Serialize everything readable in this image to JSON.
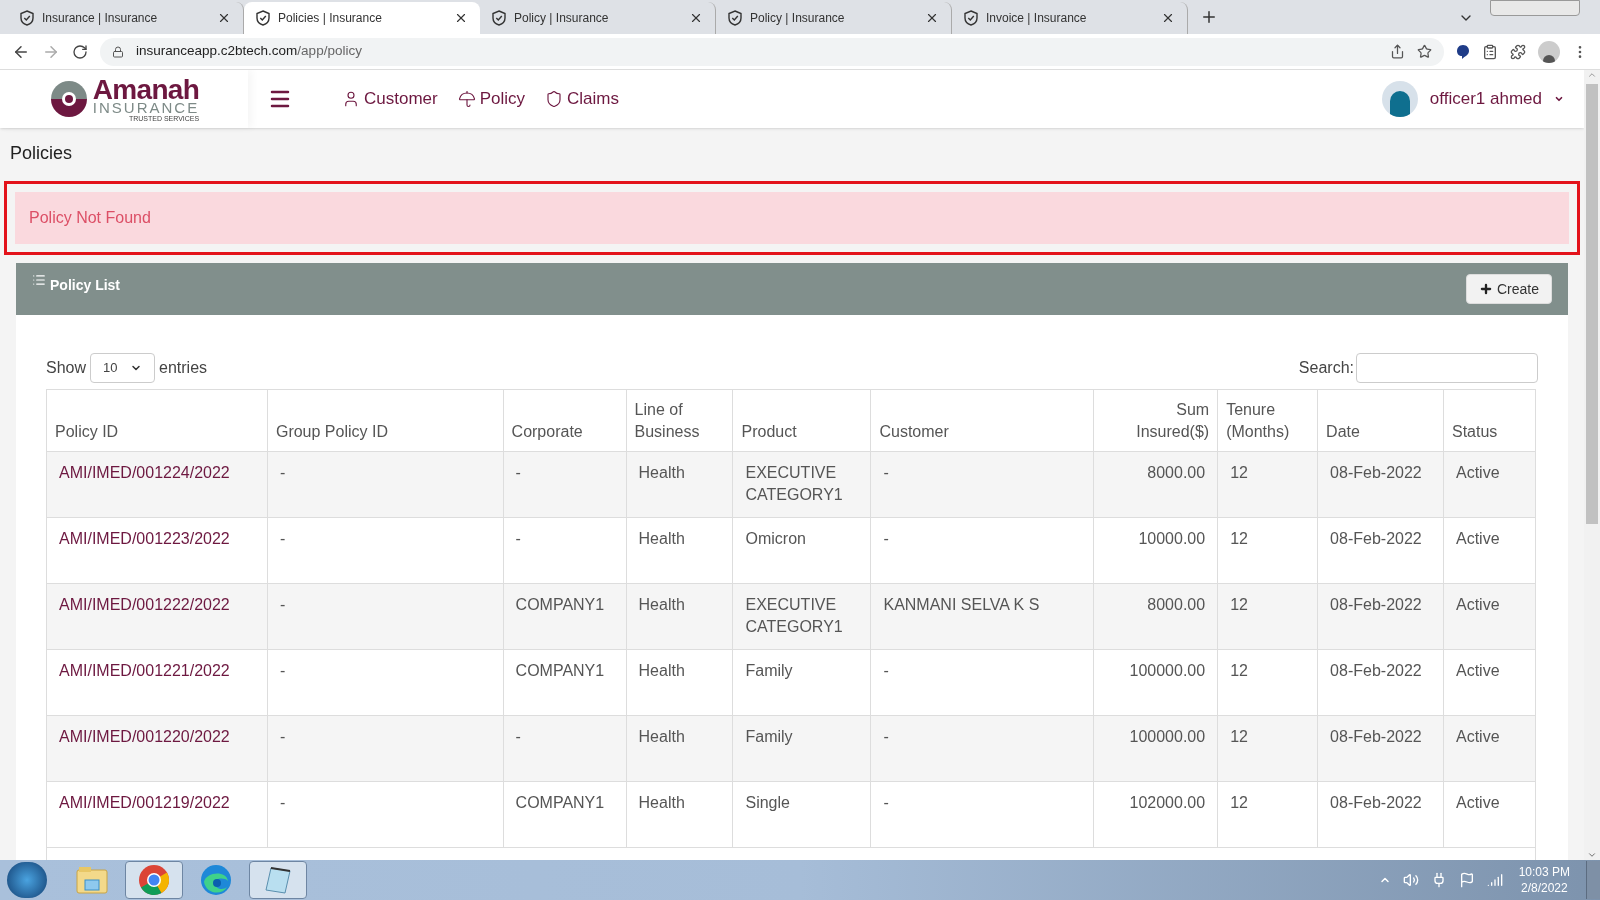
{
  "browser": {
    "tabs": [
      {
        "label": "Insurance | Insurance",
        "selected": false
      },
      {
        "label": "Policies | Insurance",
        "selected": true
      },
      {
        "label": "Policy | Insurance",
        "selected": false
      },
      {
        "label": "Policy | Insurance",
        "selected": false
      },
      {
        "label": "Invoice | Insurance",
        "selected": false
      }
    ],
    "url_host": "insuranceapp.c2btech.com",
    "url_path": "/app/policy"
  },
  "header": {
    "logo": {
      "name": "Amanah",
      "sub": "INSURANCE",
      "tagline": "TRUSTED SERVICES"
    },
    "nav": [
      {
        "label": "Customer",
        "kind": "person"
      },
      {
        "label": "Policy",
        "kind": "umbrella"
      },
      {
        "label": "Claims",
        "kind": "shield"
      }
    ],
    "user": "officer1 ahmed"
  },
  "page_title": "Policies",
  "alert": "Policy Not Found",
  "panel": {
    "title": "Policy List",
    "create_button": "Create",
    "show_label": "Show",
    "page_size": "10",
    "entries_label": "entries",
    "search_label": "Search:"
  },
  "table": {
    "columns": [
      {
        "label": "Policy ID"
      },
      {
        "label": "Group Policy ID"
      },
      {
        "label": "Corporate"
      },
      {
        "label": "Line of Business"
      },
      {
        "label": "Product"
      },
      {
        "label": "Customer"
      },
      {
        "label": "Sum Insured($)"
      },
      {
        "label": "Tenure (Months)"
      },
      {
        "label": "Date"
      },
      {
        "label": "Status"
      }
    ],
    "rows": [
      [
        "AMI/IMED/001224/2022",
        "-",
        "-",
        "Health",
        "EXECUTIVE CATEGORY1",
        "-",
        "8000.00",
        "12",
        "08-Feb-2022",
        "Active"
      ],
      [
        "AMI/IMED/001223/2022",
        "-",
        "-",
        "Health",
        "Omicron",
        "-",
        "10000.00",
        "12",
        "08-Feb-2022",
        "Active"
      ],
      [
        "AMI/IMED/001222/2022",
        "-",
        "COMPANY1",
        "Health",
        "EXECUTIVE CATEGORY1",
        "KANMANI SELVA K S",
        "8000.00",
        "12",
        "08-Feb-2022",
        "Active"
      ],
      [
        "AMI/IMED/001221/2022",
        "-",
        "COMPANY1",
        "Health",
        "Family",
        "-",
        "100000.00",
        "12",
        "08-Feb-2022",
        "Active"
      ],
      [
        "AMI/IMED/001220/2022",
        "-",
        "-",
        "Health",
        "Family",
        "-",
        "100000.00",
        "12",
        "08-Feb-2022",
        "Active"
      ],
      [
        "AMI/IMED/001219/2022",
        "-",
        "COMPANY1",
        "Health",
        "Single",
        "-",
        "102000.00",
        "12",
        "08-Feb-2022",
        "Active"
      ]
    ]
  },
  "taskbar": {
    "apps": [
      {
        "kind": "folder",
        "open": false
      },
      {
        "kind": "chrome",
        "open": true
      },
      {
        "kind": "edge",
        "open": false
      },
      {
        "kind": "notepad",
        "open": true
      }
    ],
    "time": "10:03 PM",
    "date": "2/8/2022"
  }
}
